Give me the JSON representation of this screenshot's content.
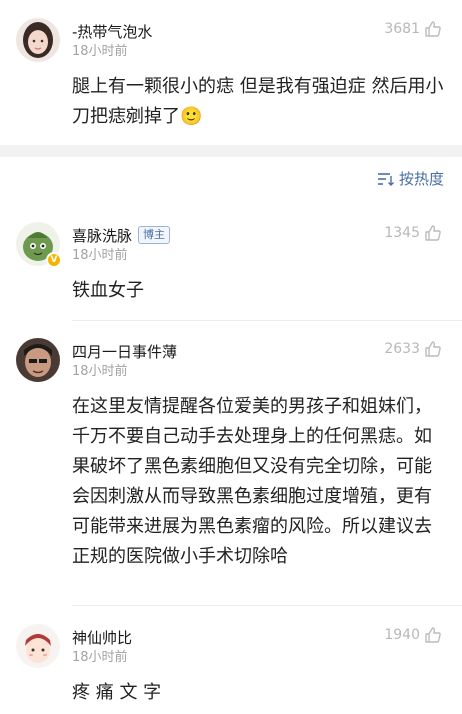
{
  "top_comment": {
    "username": "-热带气泡水",
    "time": "18小时前",
    "likes": "3681",
    "text": "腿上有一颗很小的痣 但是我有强迫症 然后用小刀把痣剜掉了🙂"
  },
  "sort": {
    "label": "按热度"
  },
  "comments": [
    {
      "username": "喜脉洗脉",
      "badge": "博主",
      "time": "18小时前",
      "likes": "1345",
      "text": "铁血女子"
    },
    {
      "username": "四月一日事件薄",
      "time": "18小时前",
      "likes": "2633",
      "text": "在这里友情提醒各位爱美的男孩子和姐妹们，千万不要自己动手去处理身上的任何黑痣。如果破坏了黑色素细胞但又没有完全切除，可能会因刺激从而导致黑色素细胞过度增殖，更有可能带来进展为黑色素瘤的风险。所以建议去正规的医院做小手术切除哈"
    },
    {
      "username": "神仙帅比",
      "time": "18小时前",
      "likes": "1940",
      "text": "疼 痛 文 字"
    }
  ],
  "colors": {
    "link": "#4a6fa5",
    "muted": "#a3a3a3",
    "separator": "#f2f2f2"
  }
}
